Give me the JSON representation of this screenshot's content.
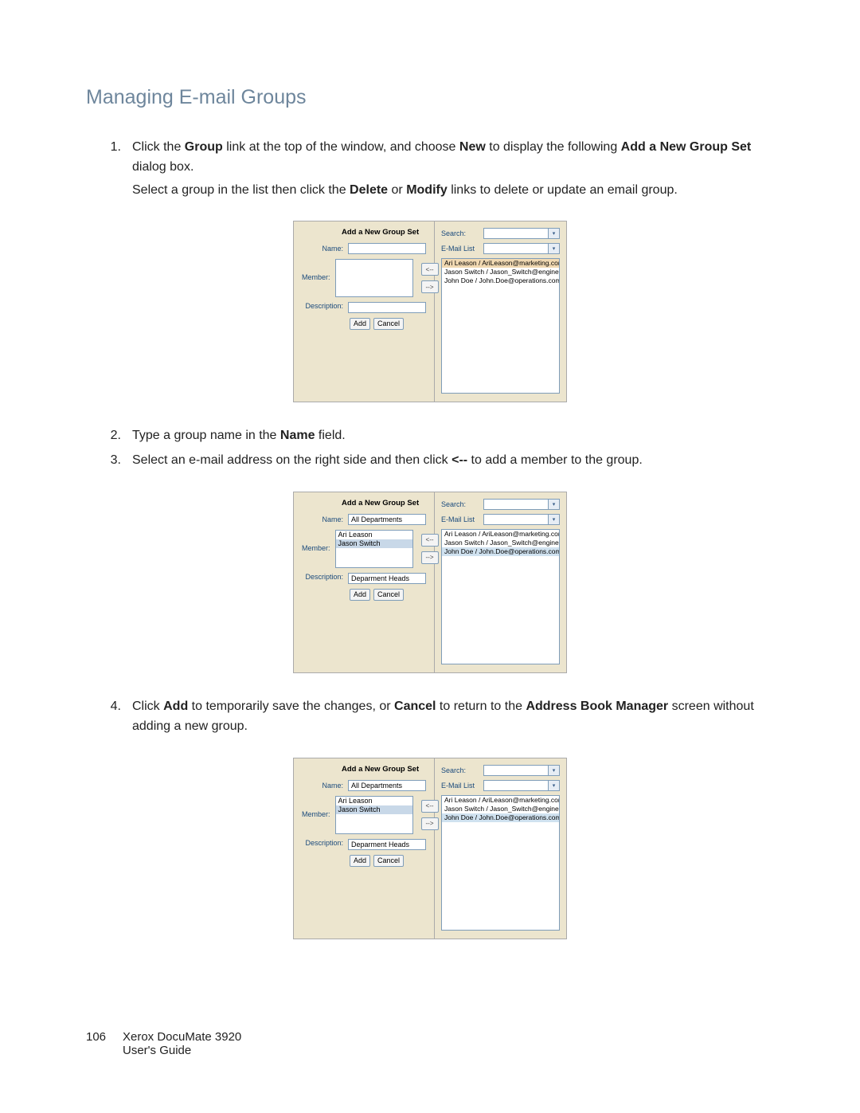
{
  "heading": "Managing E-mail Groups",
  "steps": {
    "s1": {
      "num": "1.",
      "p1_a": "Click the ",
      "p1_group": "Group",
      "p1_b": " link at the top of the window, and choose ",
      "p1_new": "New",
      "p1_c": " to display the following ",
      "p1_add": "Add a New Group Set",
      "p1_d": " dialog box.",
      "p2_a": "Select a group in the list then click the ",
      "p2_delete": "Delete",
      "p2_b": " or ",
      "p2_modify": "Modify",
      "p2_c": " links to delete or update an email group."
    },
    "s2": {
      "num": "2.",
      "a": "Type a group name in the ",
      "name": "Name",
      "b": " field."
    },
    "s3": {
      "num": "3.",
      "a": "Select an e-mail address on the right side and then click ",
      "arrow": "<--",
      "b": " to add a member to the group."
    },
    "s4": {
      "num": "4.",
      "a": "Click ",
      "add": "Add",
      "b": " to temporarily save the changes, or ",
      "cancel": "Cancel",
      "c": " to return to the ",
      "abm": "Address Book Manager",
      "d": " screen without adding a new group."
    }
  },
  "dialog": {
    "title": "Add a New Group Set",
    "labels": {
      "name": "Name:",
      "member": "Member:",
      "description": "Description:"
    },
    "buttons": {
      "add": "Add",
      "cancel": "Cancel"
    },
    "arrows": {
      "left": "<--",
      "right": "-->"
    },
    "search_label": "Search:",
    "filter_label": "E-Mail List",
    "contacts": [
      "Ari Leason / AriLeason@marketing.com / Ma",
      "Jason Switch / Jason_Switch@engineering.co",
      "John Doe / John.Doe@operations.com / Oper"
    ]
  },
  "figB": {
    "name": "All Departments",
    "members": [
      "Ari Leason",
      "Jason Switch"
    ],
    "description": "Deparment Heads"
  },
  "footer": {
    "page": "106",
    "line1": "Xerox DocuMate 3920",
    "line2": "User's Guide"
  }
}
